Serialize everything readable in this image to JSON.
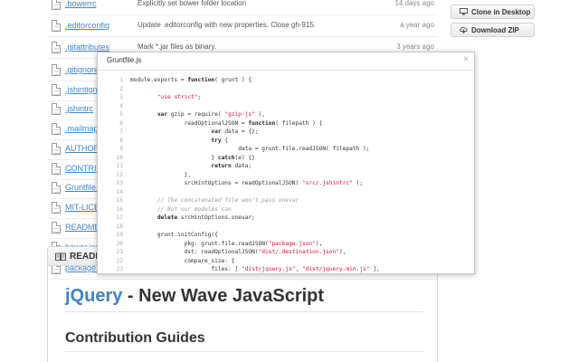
{
  "files": [
    {
      "name": ".bowerrc",
      "message": "Explicitly set bower folder location",
      "age": "14 days ago"
    },
    {
      "name": ".editorconfig",
      "message": "Update .editorconfig with new properties. Close gh-915.",
      "age": "a year ago"
    },
    {
      "name": ".gitattributes",
      "message": "Mark *.jar files as binary.",
      "age": "3 years ago"
    },
    {
      "name": ".gitignore",
      "message": "",
      "age": ""
    },
    {
      "name": ".jshintignore",
      "message": "",
      "age": ""
    },
    {
      "name": ".jshintrc",
      "message": "",
      "age": ""
    },
    {
      "name": ".mailmap",
      "message": "",
      "age": ""
    },
    {
      "name": "AUTHORS.t",
      "message": "",
      "age": ""
    },
    {
      "name": "CONTRIBUT",
      "message": "",
      "age": ""
    },
    {
      "name": "Gruntfile.js",
      "message": "",
      "age": ""
    },
    {
      "name": "MIT-LICEN",
      "message": "",
      "age": ""
    },
    {
      "name": "README.m",
      "message": "",
      "age": ""
    },
    {
      "name": "bower.json",
      "message": "",
      "age": ""
    },
    {
      "name": "package.js",
      "message": "",
      "age": ""
    }
  ],
  "sidebar": {
    "clone_label": "Clone in Desktop",
    "download_label": "Download ZIP"
  },
  "readme": {
    "title": "README",
    "h1_brand": "jQuery",
    "h1_rest": " - New Wave JavaScript",
    "h2": "Contribution Guides"
  },
  "popup": {
    "title": "Gruntfile.js",
    "close_glyph": "×",
    "lines": [
      {
        "n": "1",
        "t": "module.exports = function( grunt ) {"
      },
      {
        "n": "2",
        "t": ""
      },
      {
        "n": "3",
        "t": "        \"use strict\";"
      },
      {
        "n": "4",
        "t": ""
      },
      {
        "n": "5",
        "t": "        var gzip = require( \"gzip-js\" ),"
      },
      {
        "n": "6",
        "t": "                readOptionalJSON = function( filepath ) {"
      },
      {
        "n": "7",
        "t": "                        var data = {};"
      },
      {
        "n": "8",
        "t": "                        try {"
      },
      {
        "n": "9",
        "t": "                                data = grunt.file.readJSON( filepath );"
      },
      {
        "n": "10",
        "t": "                        } catch(e) {}"
      },
      {
        "n": "11",
        "t": "                        return data;"
      },
      {
        "n": "12",
        "t": "                },"
      },
      {
        "n": "13",
        "t": "                srcHintOptions = readOptionalJSON( \"src/.jshintrc\" );"
      },
      {
        "n": "14",
        "t": ""
      },
      {
        "n": "15",
        "t": "        // The concatenated file won't pass onevar"
      },
      {
        "n": "16",
        "t": "        // But our modules can"
      },
      {
        "n": "17",
        "t": "        delete srcHintOptions.onevar;"
      },
      {
        "n": "18",
        "t": ""
      },
      {
        "n": "19",
        "t": "        grunt.initConfig({"
      },
      {
        "n": "20",
        "t": "                pkg: grunt.file.readJSON(\"package.json\"),"
      },
      {
        "n": "21",
        "t": "                dst: readOptionalJSON(\"dist/.destination.json\"),"
      },
      {
        "n": "22",
        "t": "                compare_size: {"
      },
      {
        "n": "23",
        "t": "                        files: [ \"dist/jquery.js\", \"dist/jquery.min.js\" ],"
      }
    ]
  },
  "colors": {
    "link": "#4183c4",
    "string": "#dd1144",
    "comment": "#999999"
  }
}
